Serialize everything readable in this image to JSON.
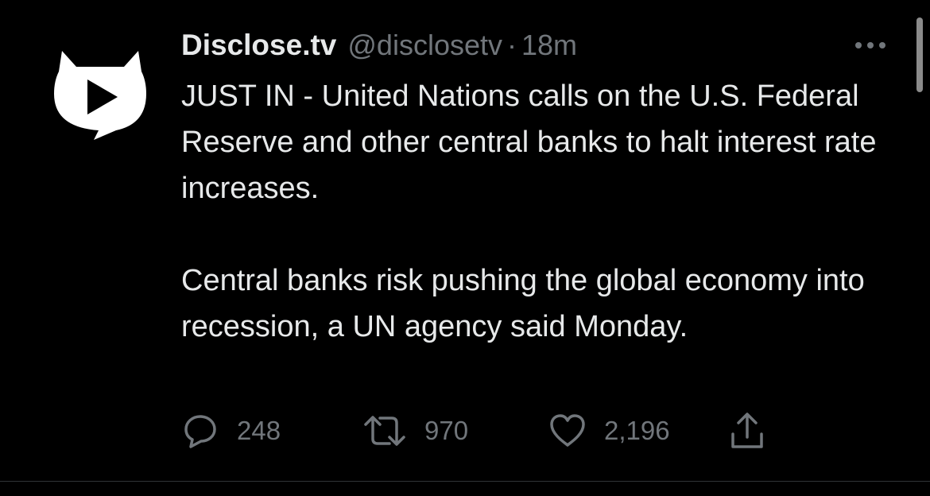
{
  "tweet": {
    "author_name": "Disclose.tv",
    "handle": "@disclosetv",
    "separator": "·",
    "time": "18m",
    "text_para1": "JUST IN - United Nations calls on the U.S. Federal Reserve and other central banks to halt interest rate increases.",
    "text_para2": "Central banks risk pushing the global economy into recession, a UN agency said Monday.",
    "replies": "248",
    "retweets": "970",
    "likes": "2,196"
  },
  "icons": {
    "avatar": "disclose-tv-logo",
    "more": "more-dots-icon",
    "reply": "reply-icon",
    "retweet": "retweet-icon",
    "like": "heart-icon",
    "share": "share-icon"
  },
  "colors": {
    "background": "#000000",
    "text": "#e7e9ea",
    "secondary": "#71767b",
    "divider": "#2f3336"
  }
}
